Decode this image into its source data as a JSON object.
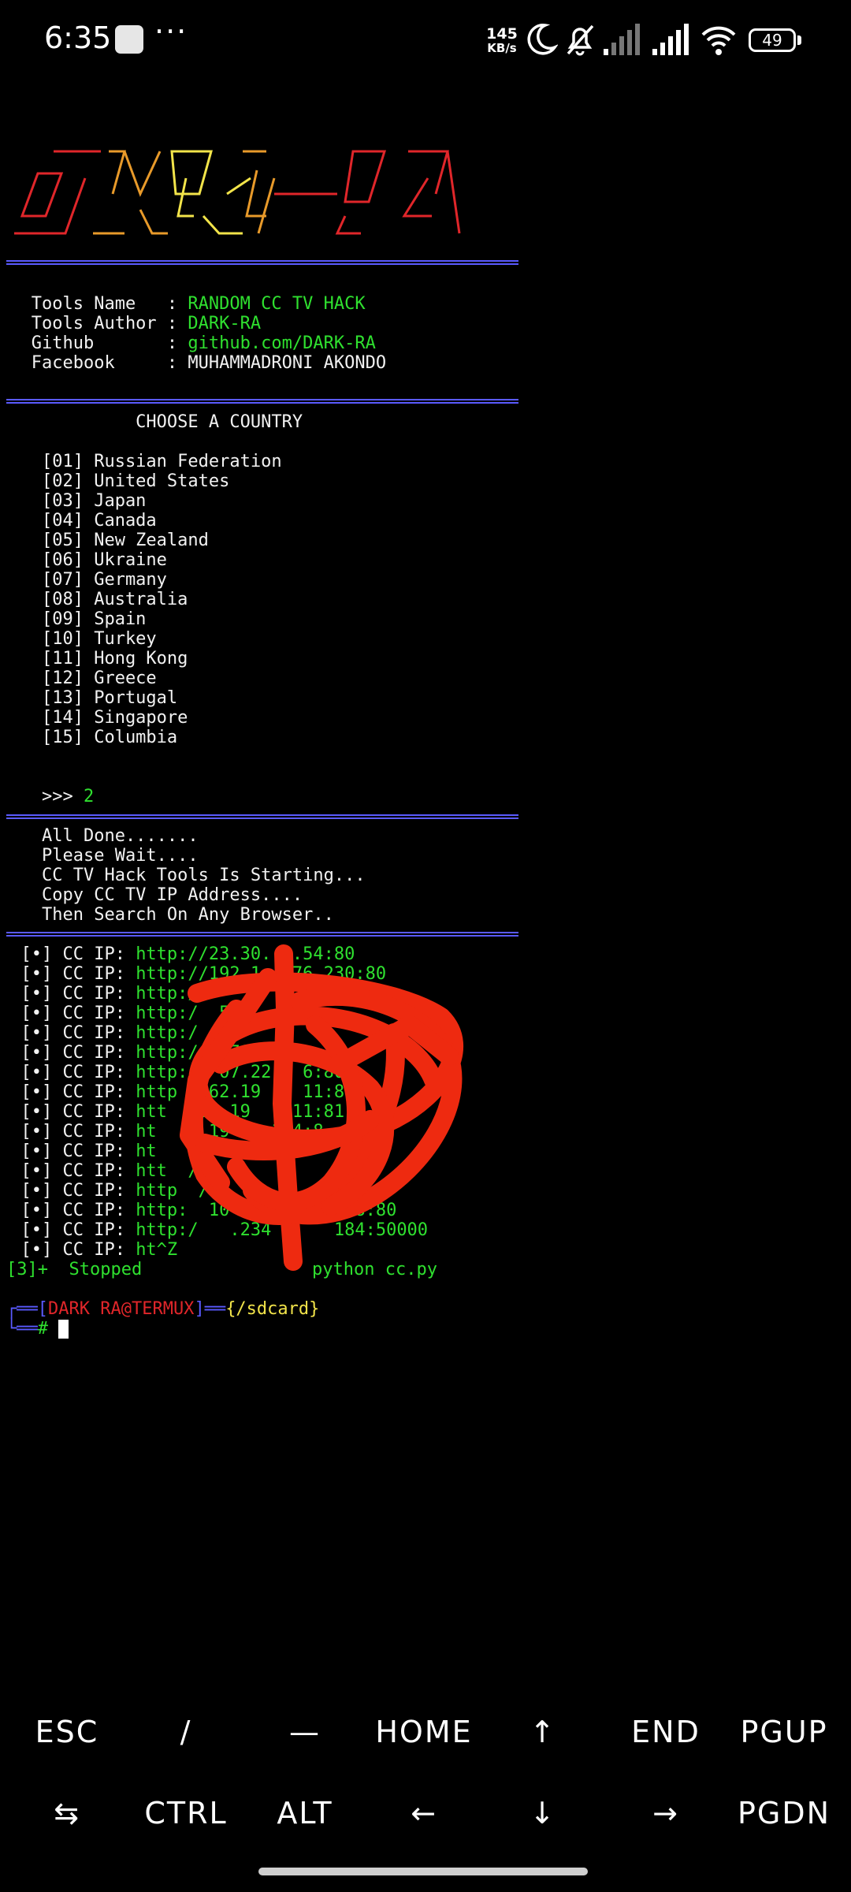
{
  "status_bar": {
    "time": "6:35",
    "speed_value": "145",
    "speed_unit": "KB/s",
    "battery": "49",
    "icons": [
      "app-notification-icon",
      "more-dots-icon",
      "moon-icon",
      "mute-bell-icon",
      "signal-icon",
      "signal-icon",
      "wifi-icon",
      "battery-icon"
    ]
  },
  "banner": {
    "colors": [
      "#e0262a",
      "#e89a2a",
      "#f2e44a",
      "#5a5aff"
    ]
  },
  "info": {
    "tools_name_label": "   Tools Name   : ",
    "tools_name_value": "RANDOM CC TV HACK",
    "tools_author_label": "   Tools Author : ",
    "tools_author_value": "DARK-RA",
    "github_label": "   Github       : ",
    "github_value": "github.com/DARK-RA",
    "facebook_label": "   Facebook     : ",
    "facebook_value": "MUHAMMADRONI AKONDO"
  },
  "menu": {
    "title": "             CHOOSE A COUNTRY",
    "items": [
      "    [01] Russian Federation",
      "    [02] United States",
      "    [03] Japan",
      "    [04] Canada",
      "    [05] New Zealand",
      "    [06] Ukraine",
      "    [07] Germany",
      "    [08] Australia",
      "    [09] Spain",
      "    [10] Turkey",
      "    [11] Hong Kong",
      "    [12] Greece",
      "    [13] Portugal",
      "    [14] Singapore",
      "    [15] Columbia"
    ],
    "prompt": "    >>> ",
    "input": "2"
  },
  "progress": [
    "    All Done.......",
    "    Please Wait....",
    "    CC TV Hack Tools Is Starting...",
    "    Copy CC TV IP Address....",
    "    Then Search On Any Browser.."
  ],
  "results": {
    "prefix": "  [•] CC IP: ",
    "urls": [
      "http://23.30.  .54:80",
      "http://192.1   76.230:80",
      "http:/              .90",
      "http:/  5.",
      "http:/",
      "http:/  /78.",
      "http:   07.22   6:808",
      "http   62.19    11:82",
      "htt   52.19    11:81",
      "ht    .19    144:8",
      "ht    7     74:8",
      "htt  /9",
      "http  /98.         46:",
      "http:  10^X  .     198:80",
      "http:/   .234      184:50000",
      "ht^Z"
    ]
  },
  "stopped": {
    "job": "[3]+  Stopped",
    "command": "python cc.py"
  },
  "prompt": {
    "corner_top": "┌══",
    "open_bracket": "[",
    "user_host": "DARK RA@TERMUX",
    "close_bracket": "]",
    "sep": "══",
    "path": "{/sdcard}",
    "corner_bottom": "└══",
    "hash": "# "
  },
  "extra_keys": {
    "row1": [
      "ESC",
      "/",
      "—",
      "HOME",
      "↑",
      "END",
      "PGUP"
    ],
    "row2": [
      "⇆",
      "CTRL",
      "ALT",
      "←",
      "↓",
      "→",
      "PGDN"
    ]
  }
}
